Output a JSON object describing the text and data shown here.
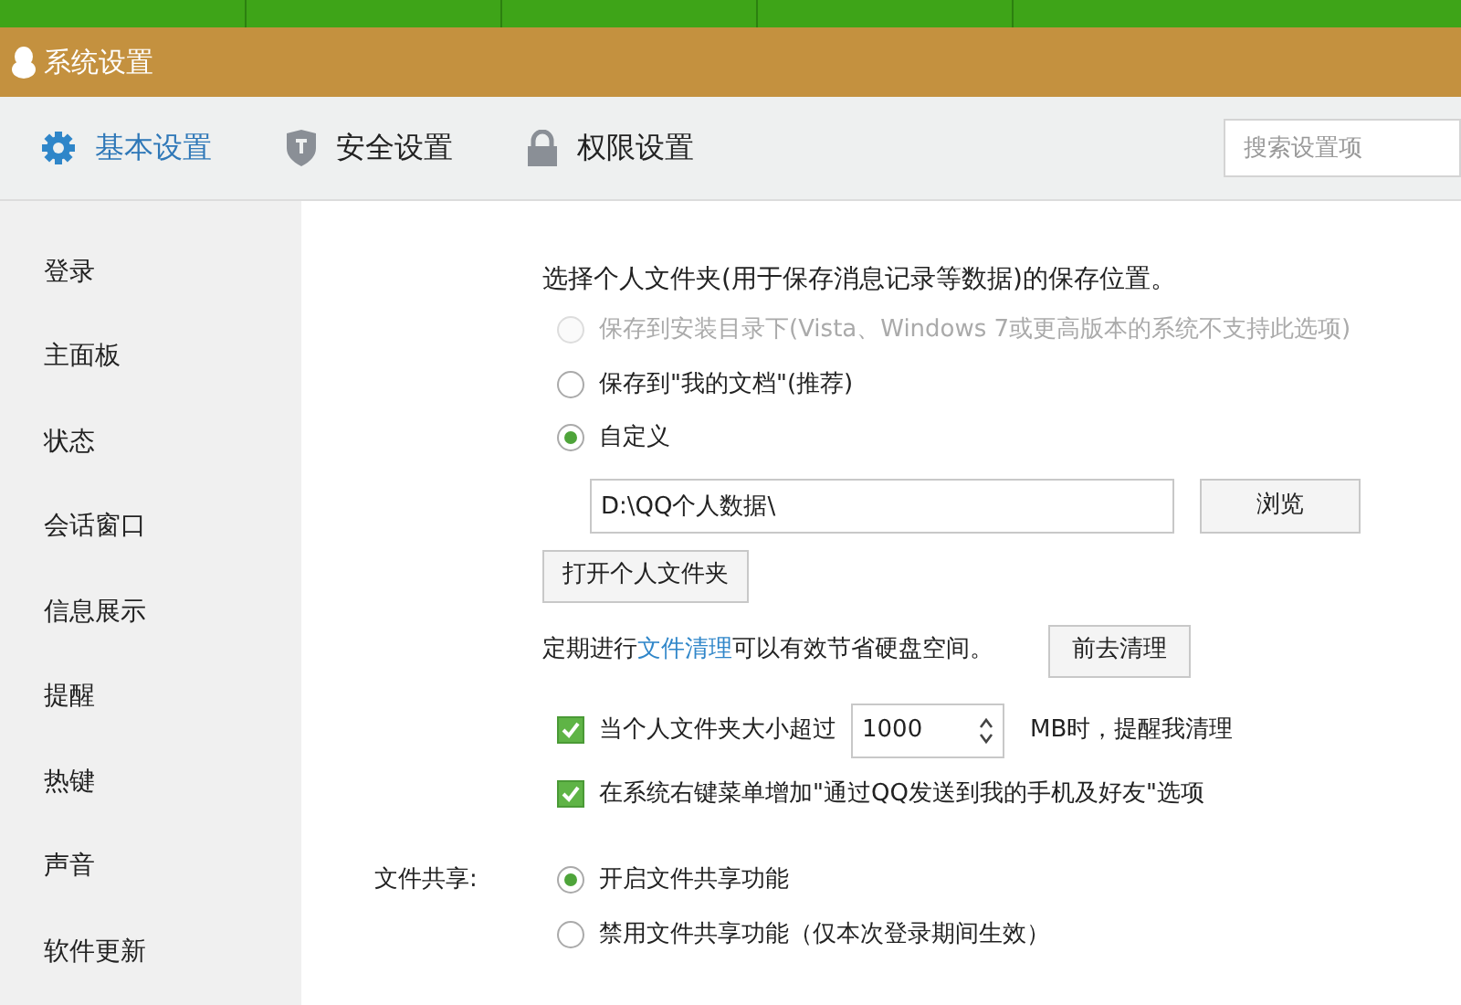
{
  "window": {
    "title": "系统设置"
  },
  "tabs": [
    {
      "label": "基本设置",
      "selected": true,
      "kind": "gear"
    },
    {
      "label": "安全设置",
      "selected": false,
      "kind": "shield"
    },
    {
      "label": "权限设置",
      "selected": false,
      "kind": "lock"
    }
  ],
  "search": {
    "placeholder": "搜索设置项"
  },
  "sidebar": {
    "items": [
      {
        "label": "登录",
        "selected": false
      },
      {
        "label": "主面板",
        "selected": false
      },
      {
        "label": "状态",
        "selected": false
      },
      {
        "label": "会话窗口",
        "selected": false
      },
      {
        "label": "信息展示",
        "selected": false
      },
      {
        "label": "提醒",
        "selected": false
      },
      {
        "label": "热键",
        "selected": false
      },
      {
        "label": "声音",
        "selected": false
      },
      {
        "label": "软件更新",
        "selected": false
      }
    ]
  },
  "folder": {
    "heading": "选择个人文件夹(用于保存消息记录等数据)的保存位置。",
    "options": [
      {
        "label": "保存到安装目录下(Vista、Windows 7或更高版本的系统不支持此选项)",
        "selected": false,
        "disabled": true
      },
      {
        "label": "保存到\"我的文档\"(推荐)",
        "selected": false,
        "disabled": false
      },
      {
        "label": "自定义",
        "selected": true,
        "disabled": false
      }
    ],
    "path": "D:\\QQ个人数据\\",
    "browse_button": "浏览",
    "open_button": "打开个人文件夹"
  },
  "cleanup": {
    "text_before": "定期进行",
    "link": "文件清理",
    "text_after": "可以有效节省硬盘空间。",
    "button": "前去清理"
  },
  "checks": [
    {
      "kind": "size",
      "before": "当个人文件夹大小超过",
      "value": "1000",
      "after": "MB时，提醒我清理",
      "checked": true
    },
    {
      "kind": "plain",
      "before": "在系统右键菜单增加\"通过QQ发送到我的手机及好友\"选项",
      "checked": true
    }
  ],
  "file_sharing": {
    "label": "文件共享:",
    "options": [
      {
        "label": "开启文件共享功能",
        "selected": true
      },
      {
        "label": "禁用文件共享功能（仅本次登录期间生效）",
        "selected": false
      }
    ]
  }
}
